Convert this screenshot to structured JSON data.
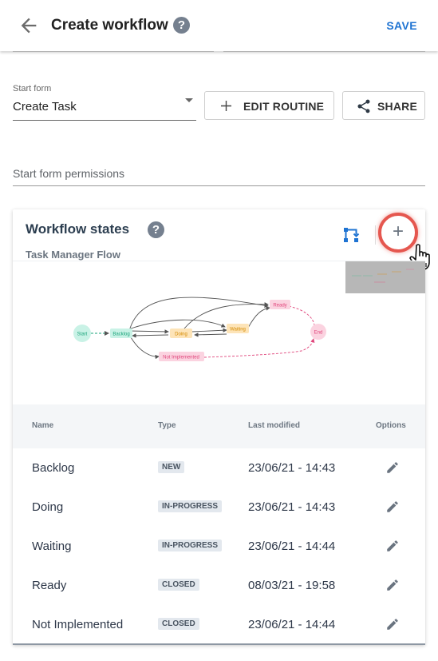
{
  "header": {
    "title": "Create workflow",
    "save_label": "SAVE"
  },
  "start_form": {
    "label": "Start form",
    "value": "Create Task"
  },
  "buttons": {
    "edit_routine": "EDIT ROUTINE",
    "share": "SHARE"
  },
  "permissions": {
    "placeholder": "Start form permissions"
  },
  "workflow": {
    "title": "Workflow states",
    "subtitle": "Task Manager Flow",
    "diagram_nodes": {
      "start": "Start",
      "backlog": "Backlog",
      "doing": "Doing",
      "waiting": "Waiting",
      "ready": "Ready",
      "end": "End",
      "not_implemented": "Not Implemented"
    }
  },
  "table": {
    "headers": {
      "name": "Name",
      "type": "Type",
      "last_modified": "Last modified",
      "options": "Options"
    },
    "rows": [
      {
        "name": "Backlog",
        "type": "NEW",
        "modified": "23/06/21 - 14:43"
      },
      {
        "name": "Doing",
        "type": "IN-PROGRESS",
        "modified": "23/06/21 - 14:43"
      },
      {
        "name": "Waiting",
        "type": "IN-PROGRESS",
        "modified": "23/06/21 - 14:44"
      },
      {
        "name": "Ready",
        "type": "CLOSED",
        "modified": "08/03/21 - 19:58"
      },
      {
        "name": "Not Implemented",
        "type": "CLOSED",
        "modified": "23/06/21 - 14:44"
      }
    ]
  },
  "icons": {
    "back": "arrow-back-icon",
    "help": "help-icon",
    "add": "plus-icon",
    "share": "share-icon",
    "edit": "pencil-icon",
    "branch": "branch-icon",
    "cursor": "hand-pointer-icon",
    "dropdown": "dropdown-arrow-icon"
  },
  "colors": {
    "accent": "#1e73d2",
    "highlight_ring": "#e5574f",
    "start_node": "#c9f2e6",
    "doing_node": "#fde4b8",
    "ready_node": "#fbd3e0",
    "end_node": "#fbd3e0",
    "flow_magenta": "#e0457b"
  }
}
